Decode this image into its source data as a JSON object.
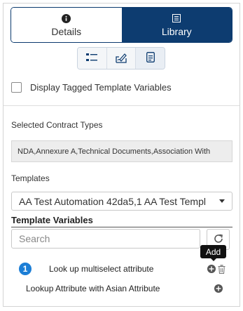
{
  "tabs": [
    {
      "label": "Details",
      "icon": "info-icon"
    },
    {
      "label": "Library",
      "icon": "list-icon"
    }
  ],
  "view_buttons": [
    "list-view-icon",
    "edit-signature-icon",
    "document-icon"
  ],
  "display_tagged_label": "Display Tagged Template Variables",
  "selected_contract_types": {
    "label": "Selected Contract Types",
    "value": "NDA,Annexure A,Technical Documents,Association With"
  },
  "templates": {
    "label": "Templates",
    "selected": "AA Test Automation 42da5,1 AA Test Templ"
  },
  "template_variables": {
    "heading": "Template Variables",
    "search_placeholder": "Search",
    "tooltip": "Add",
    "items": [
      {
        "badge": "1",
        "label": "Look up multiselect attribute"
      },
      {
        "label": "Lookup Attribute with Asian Attribute"
      }
    ]
  },
  "colors": {
    "primary": "#0d3c70",
    "badge": "#1c7ed6"
  }
}
